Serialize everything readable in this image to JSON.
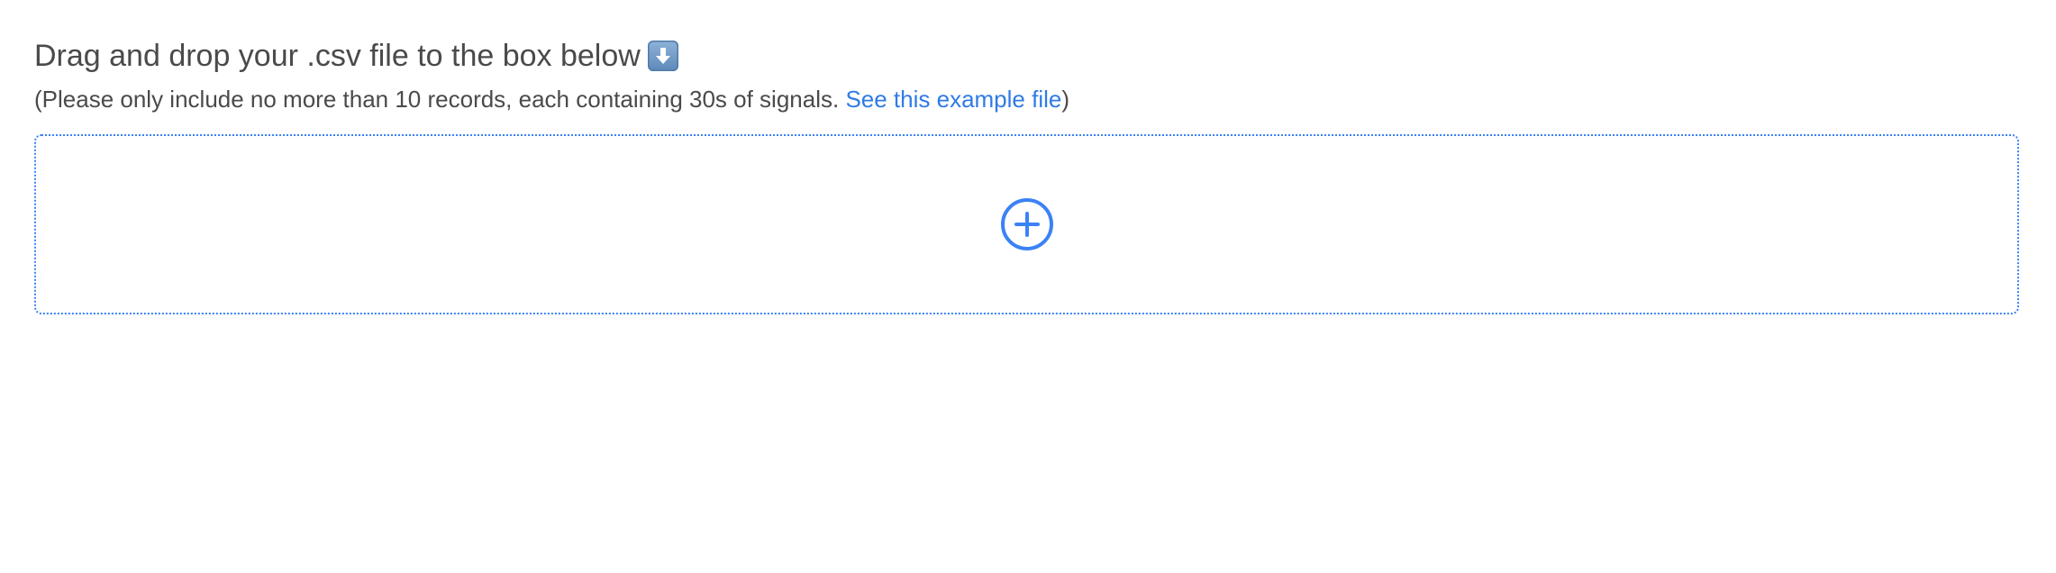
{
  "upload": {
    "heading": "Drag and drop your .csv file to the box below",
    "heading_icon": "down-arrow-emoji-icon",
    "note_prefix": "(Please only include no more than 10 records, each containing 30s of signals. ",
    "note_link": "See this example file",
    "note_suffix": ")",
    "dropzone_icon": "plus-circle-icon"
  },
  "colors": {
    "accent": "#2f7be5",
    "dropzone_border": "#3b82f6",
    "text": "#4a4a4a"
  }
}
